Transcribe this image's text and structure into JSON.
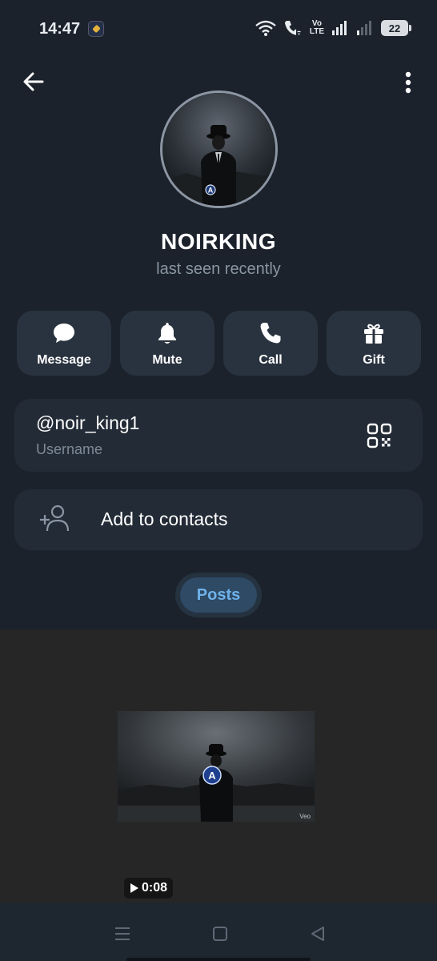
{
  "status_bar": {
    "time": "14:47",
    "volte_top": "Vo",
    "volte_bottom": "LTE",
    "battery": "22"
  },
  "header": {
    "back_icon": "arrow-left-icon",
    "menu_icon": "more-vertical-icon"
  },
  "profile": {
    "name": "NOIRKING",
    "status": "last seen recently"
  },
  "actions": [
    {
      "label": "Message",
      "icon": "chat-bubble-icon"
    },
    {
      "label": "Mute",
      "icon": "bell-icon"
    },
    {
      "label": "Call",
      "icon": "phone-icon"
    },
    {
      "label": "Gift",
      "icon": "gift-icon"
    }
  ],
  "username": {
    "value": "@noir_king1",
    "caption": "Username",
    "qr_icon": "qr-code-icon"
  },
  "contacts": {
    "label": "Add to contacts",
    "icon": "add-person-icon"
  },
  "tabs": {
    "posts": "Posts"
  },
  "media": {
    "duration": "0:08",
    "watermark": "Veo"
  },
  "colors": {
    "background": "#1b222b",
    "card": "#222b36",
    "action": "#29333f",
    "accent": "#6fb2ea"
  }
}
